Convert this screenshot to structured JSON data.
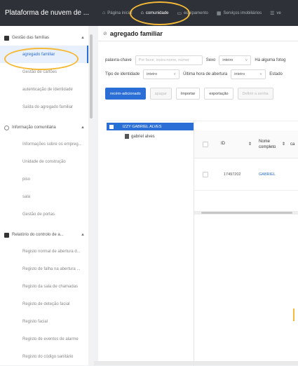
{
  "app": {
    "title": "Plataforma de nuvem de ..."
  },
  "topnav": [
    {
      "label": "Página inicial",
      "icon": "home-icon"
    },
    {
      "label": "comunidade",
      "icon": "home-icon"
    },
    {
      "label": "equipamento",
      "icon": "device-icon"
    },
    {
      "label": "Serviços imobiliários",
      "icon": "building-icon"
    },
    {
      "label": "ve",
      "icon": "list-icon"
    }
  ],
  "sidebar": {
    "group1": {
      "label": "Gestão das famílias"
    },
    "items1": [
      "agregado familiar",
      "Gestão de cartões",
      "autenticação de identidade",
      "Saída do agregado familiar"
    ],
    "group2": {
      "label": "Informação comunitária"
    },
    "items2": [
      "Informações sobre os empreg...",
      "Unidade de construção",
      "piso",
      "sala",
      "Gestão de portas"
    ],
    "group3": {
      "label": "Relatório do controlo de a..."
    },
    "items3": [
      "Registo normal de abertura d...",
      "Registo de falha na abertura ...",
      "Registo da sala de chamadas",
      "Registo de deteção facial",
      "Registo facial",
      "Registo de eventos de alarme",
      "Registo do código sanitário"
    ]
  },
  "page": {
    "title": "agregado familiar"
  },
  "filters": {
    "keyword_label": "palavra-chave",
    "keyword_placeholder": "Por favor, insira nome, númer",
    "sex_label": "Sexo",
    "sex_value": "inteiro",
    "photo_label": "Há alguma fotog",
    "idtype_label": "Tipo de identidade",
    "idtype_value": "inteiro",
    "lastopen_label": "Última hora de abertura",
    "lastopen_value": "inteiro",
    "state_label": "Estado"
  },
  "actions": {
    "new": "recém-adicionado",
    "delete": "apagar",
    "import": "Importar",
    "export": "exportação",
    "reset_password": "Definir a senha"
  },
  "tree": {
    "root": "IZZY GABRIEL ALVES",
    "child": "gabriel alves"
  },
  "table": {
    "columns": [
      "ID",
      "Nome completo",
      "ca"
    ],
    "rows": [
      {
        "id": "17497202",
        "name": "GABRIEL",
        "extra": ""
      }
    ]
  },
  "colors": {
    "accent": "#2b6fd6",
    "highlight": "#f5b935",
    "topbar": "#2e3238"
  }
}
